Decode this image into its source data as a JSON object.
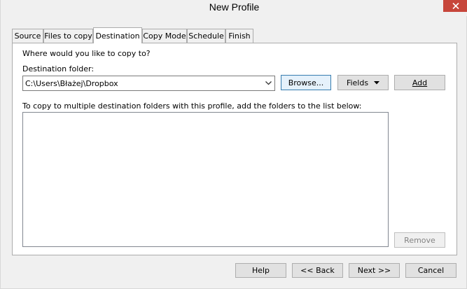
{
  "window": {
    "title": "New Profile"
  },
  "tabs": [
    {
      "label": "Source"
    },
    {
      "label": "Files to copy"
    },
    {
      "label": "Destination"
    },
    {
      "label": "Copy Mode"
    },
    {
      "label": "Schedule"
    },
    {
      "label": "Finish"
    }
  ],
  "active_tab": "Destination",
  "destination": {
    "question": "Where would you like to copy to?",
    "folder_label": "Destination folder:",
    "folder_value": "C:\\Users\\Błażej\\Dropbox",
    "browse_label": "Browse...",
    "fields_label": "Fields",
    "add_label": "Add",
    "multi_label": "To copy to multiple destination folders with this profile, add the folders to the list below:",
    "folders_list": [],
    "remove_label": "Remove"
  },
  "footer": {
    "help_label": "Help",
    "back_label": "<< Back",
    "next_label": "Next >>",
    "cancel_label": "Cancel"
  },
  "colors": {
    "close_button": "#c7463b",
    "window_bg": "#f0f0f0",
    "focus_border": "#3c7fb1"
  },
  "icons": {
    "close": "close-icon",
    "combo_arrow": "chevron-down-icon",
    "fields_arrow": "triangle-down-icon"
  }
}
